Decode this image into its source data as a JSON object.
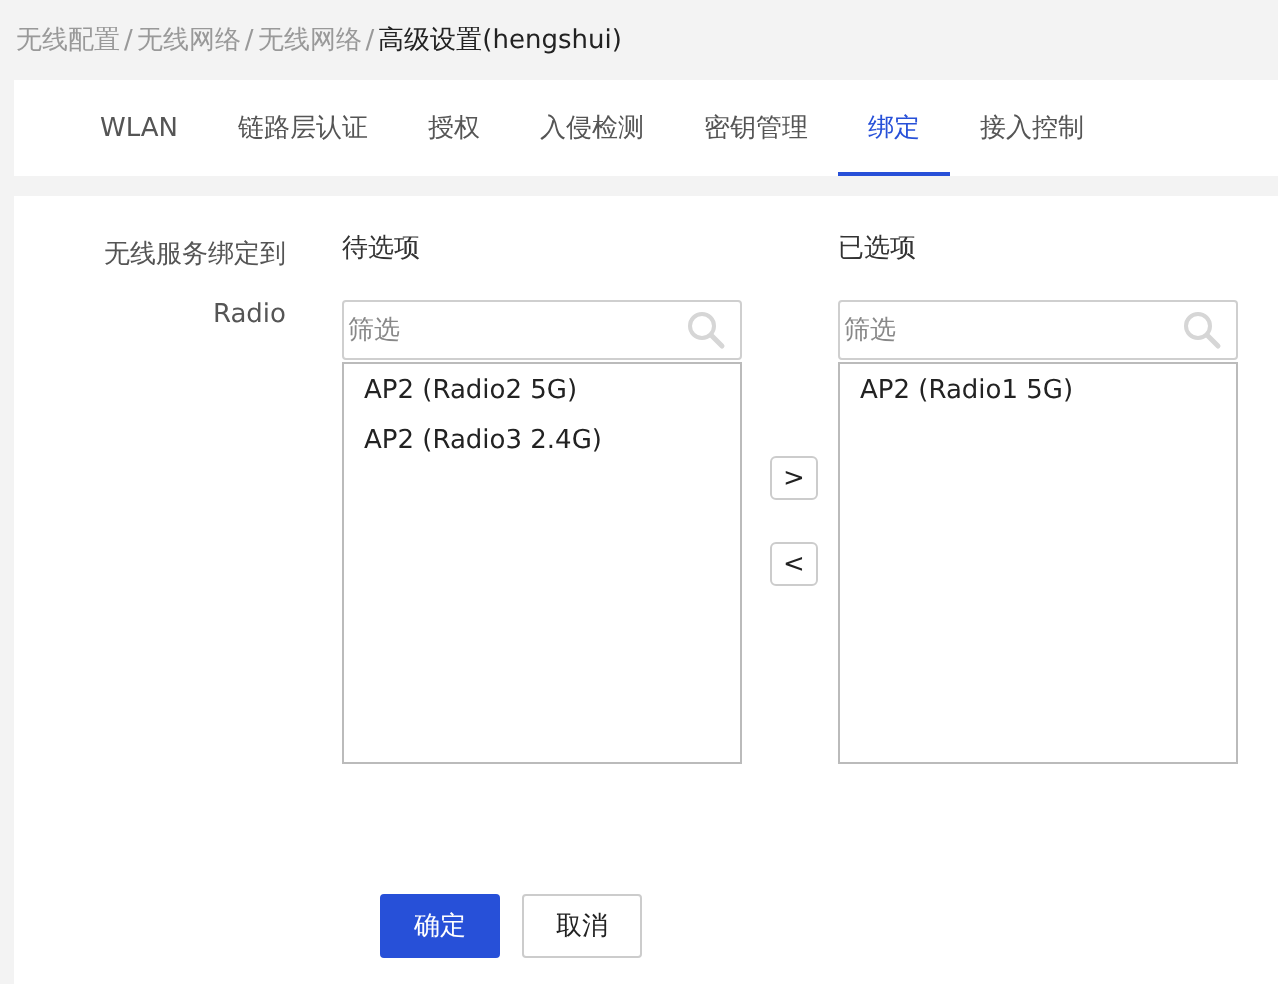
{
  "breadcrumb": [
    {
      "label": "无线配置",
      "current": false
    },
    {
      "label": "无线网络",
      "current": false
    },
    {
      "label": "无线网络",
      "current": false
    },
    {
      "label": "高级设置(hengshui)",
      "current": true
    }
  ],
  "breadcrumb_separator": "/",
  "tabs": [
    {
      "label": "WLAN",
      "selected": false
    },
    {
      "label": "链路层认证",
      "selected": false
    },
    {
      "label": "授权",
      "selected": false
    },
    {
      "label": "入侵检测",
      "selected": false
    },
    {
      "label": "密钥管理",
      "selected": false
    },
    {
      "label": "绑定",
      "selected": true
    },
    {
      "label": "接入控制",
      "selected": false
    }
  ],
  "form": {
    "labels": [
      "无线服务绑定到",
      "Radio"
    ],
    "available": {
      "title": "待选项",
      "filter_placeholder": "筛选",
      "items": [
        "AP2 (Radio2 5G)",
        "AP2 (Radio3 2.4G)"
      ]
    },
    "move_buttons": [
      ">",
      "<"
    ],
    "selected": {
      "title": "已选项",
      "filter_placeholder": "筛选",
      "items": [
        "AP2 (Radio1 5G)"
      ]
    }
  },
  "buttons": [
    {
      "label": "确定",
      "kind": "primary"
    },
    {
      "label": "取消",
      "kind": "default"
    }
  ]
}
